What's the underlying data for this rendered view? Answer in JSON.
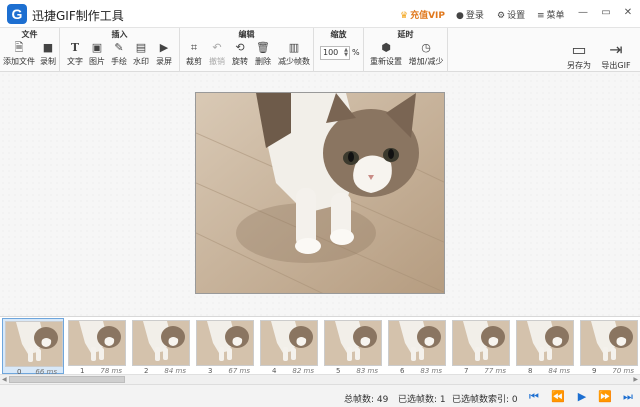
{
  "app": {
    "title": "迅捷GIF制作工具",
    "logo_letter": "G"
  },
  "titlebar": {
    "vip_label": "充值VIP",
    "login_label": "登录",
    "settings_label": "设置",
    "menu_label": "菜单"
  },
  "toolbar": {
    "groups": {
      "file": "文件",
      "insert": "插入",
      "edit": "编辑",
      "zoom": "缩放",
      "delay": "延时"
    },
    "file": {
      "add_file": "添加文件",
      "record": "录制"
    },
    "insert": {
      "text": "文字",
      "image": "图片",
      "draw": "手绘",
      "watermark": "水印",
      "screen_record": "录屏"
    },
    "edit": {
      "crop": "裁剪",
      "undo": "撤销",
      "rotate": "旋转",
      "delete": "删除",
      "reduce_frames": "减少帧数"
    },
    "zoom": {
      "value": "100",
      "unit": "%"
    },
    "delay": {
      "reset": "重新设置",
      "increase_decrease": "增加/减少"
    },
    "save_as": "另存为",
    "export_gif": "导出GIF"
  },
  "frames": [
    {
      "index": "0",
      "ms": "66 ms"
    },
    {
      "index": "1",
      "ms": "78 ms"
    },
    {
      "index": "2",
      "ms": "84 ms"
    },
    {
      "index": "3",
      "ms": "67 ms"
    },
    {
      "index": "4",
      "ms": "82 ms"
    },
    {
      "index": "5",
      "ms": "83 ms"
    },
    {
      "index": "6",
      "ms": "83 ms"
    },
    {
      "index": "7",
      "ms": "77 ms"
    },
    {
      "index": "8",
      "ms": "84 ms"
    },
    {
      "index": "9",
      "ms": "70 ms"
    }
  ],
  "status": {
    "total_frames": "总帧数: 49",
    "selected_frames": "已选帧数: 1",
    "selected_index": "已选帧数索引: 0"
  },
  "colors": {
    "accent": "#1d6fd1",
    "vip": "#e0781d"
  }
}
